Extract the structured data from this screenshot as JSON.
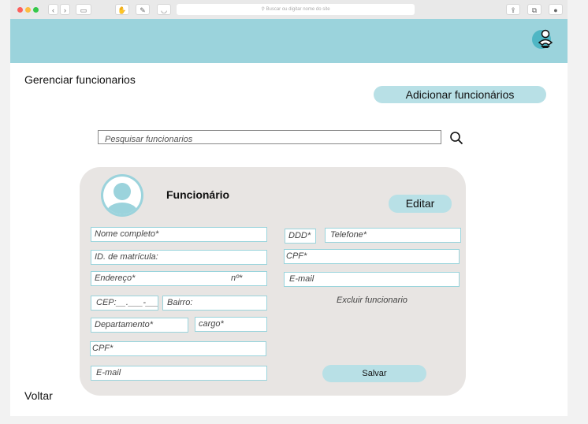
{
  "browser": {
    "url_placeholder": "Buscar ou digitar nome do site",
    "colors": {
      "close": "#fc605c",
      "minimize": "#fdbc40",
      "maximize": "#34c84a"
    }
  },
  "header": {
    "accent": "#9bd3dc",
    "user_icon": "user-icon"
  },
  "page": {
    "title": "Gerenciar funcionarios",
    "add_button": "Adicionar funcionários"
  },
  "search": {
    "placeholder": "Pesquisar funcionarios",
    "icon": "search-icon"
  },
  "card": {
    "heading": "Funcionário",
    "edit_button": "Editar",
    "fields": {
      "nome": "Nome completo*",
      "matricula": "ID. de matrícula:",
      "endereco": "Endereço*",
      "numero": "nº*",
      "cep": "CEP:__.___-___",
      "bairro": "Bairro:",
      "departamento": "Departamento*",
      "cargo": "cargo*",
      "cpf_left": "CPF*",
      "email_left": "E-mail",
      "ddd": "DDD*",
      "telefone": "Telefone*",
      "cpf_right": "CPF*",
      "email_right": "E-mail"
    },
    "delete_link": "Excluir funcionario",
    "save_button": "Salvar"
  },
  "footer": {
    "back": "Voltar"
  }
}
